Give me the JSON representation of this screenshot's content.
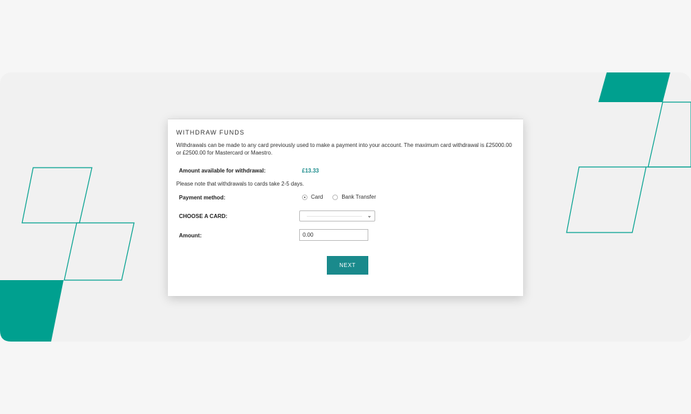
{
  "colors": {
    "accent": "#1a8a8c",
    "teal_shape": "#00a08f",
    "amount": "#1b8c8c",
    "background": "#f6f6f6"
  },
  "withdraw": {
    "title": "WITHDRAW FUNDS",
    "description": "Withdrawals can be made to any card previously used to make a payment into your account. The maximum card withdrawal is £25000.00 or £2500.00 for Mastercard or Maestro.",
    "available_label": "Amount available for withdrawal:",
    "available_value": "£13.33",
    "note": "Please note that withdrawals to cards take 2-5 days.",
    "payment_method_label": "Payment method:",
    "payment_options": [
      "Card",
      "Bank Transfer"
    ],
    "selected_payment": "Card",
    "choose_card_label": "CHOOSE A CARD:",
    "amount_label": "Amount:",
    "amount_value": "0.00",
    "next_label": "NEXT"
  }
}
